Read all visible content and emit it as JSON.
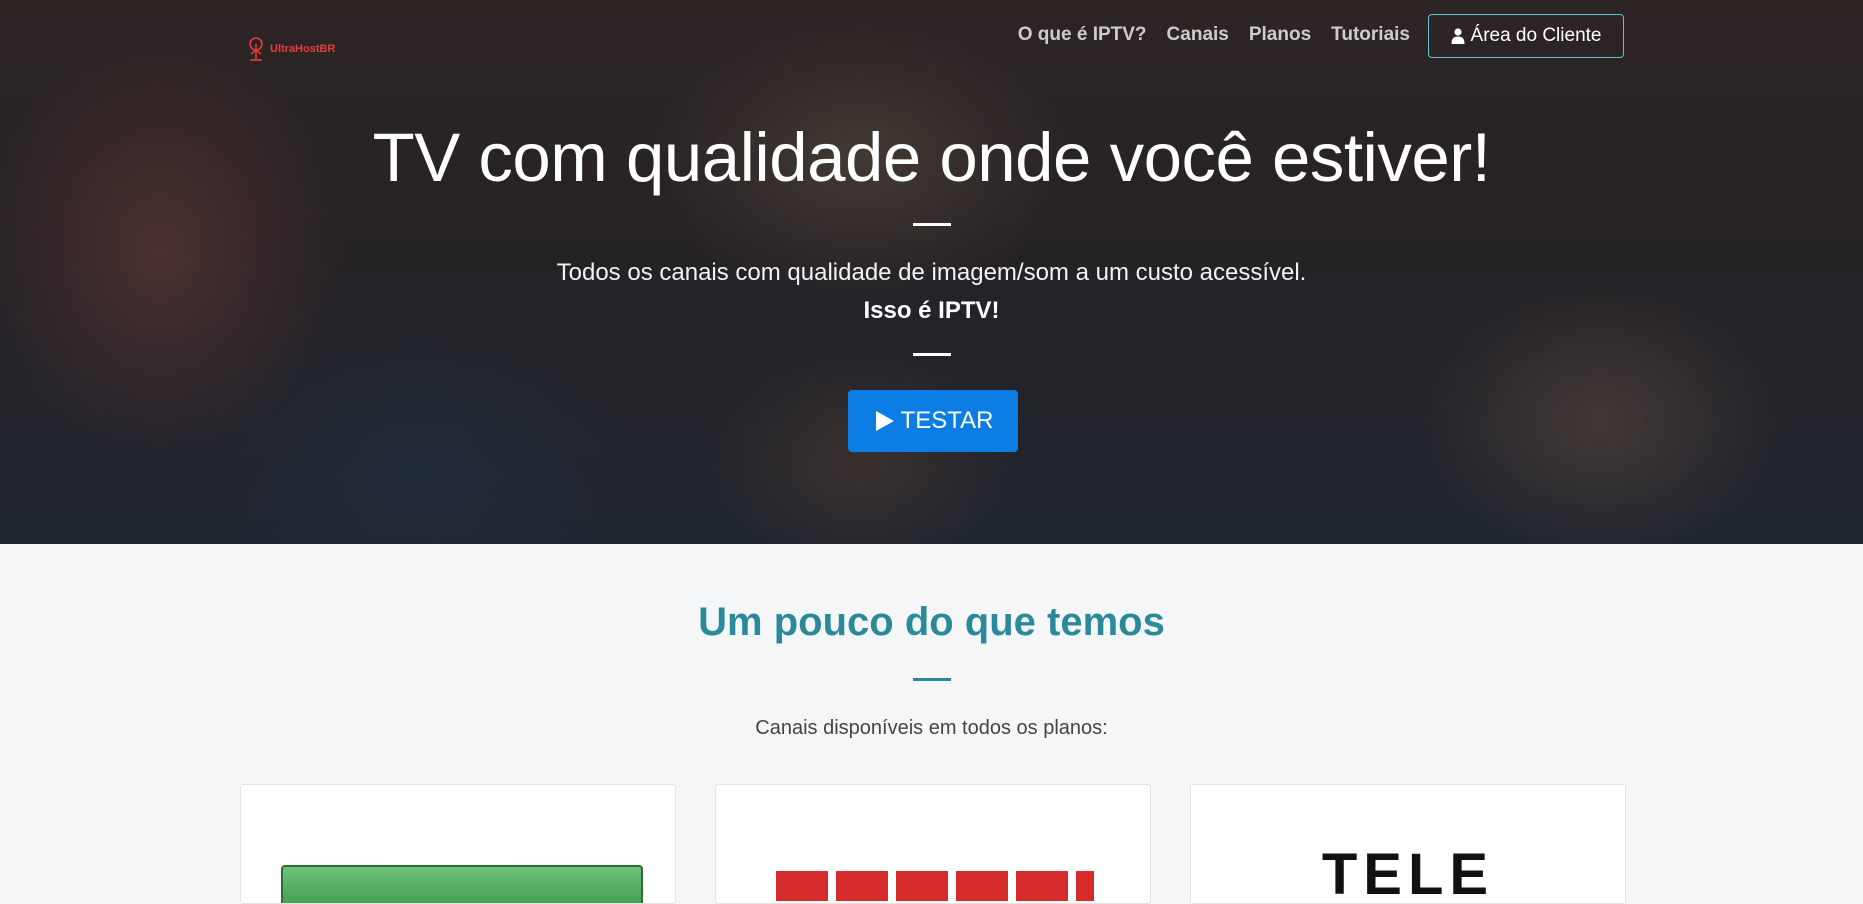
{
  "brand": {
    "name": "UltraHostBR",
    "color": "#e63b3b"
  },
  "nav": {
    "links": [
      "O que é IPTV?",
      "Canais",
      "Planos",
      "Tutoriais"
    ],
    "client_button": "Área do Cliente"
  },
  "hero": {
    "title": "TV com qualidade onde você estiver!",
    "subtitle": "Todos os canais com qualidade de imagem/som a um custo acessível.",
    "strong": "Isso é IPTV!",
    "cta": "TESTAR"
  },
  "section": {
    "title": "Um pouco do que temos",
    "subtitle": "Canais disponíveis em todos os planos:"
  },
  "channels": [
    {
      "name": "premiere-logo"
    },
    {
      "name": "combate-logo"
    },
    {
      "name": "telecine-logo",
      "visible_text": "TELE"
    }
  ],
  "colors": {
    "accent": "#2b8a9a",
    "cta": "#0d7de6",
    "client_border": "#5fc2d8"
  }
}
